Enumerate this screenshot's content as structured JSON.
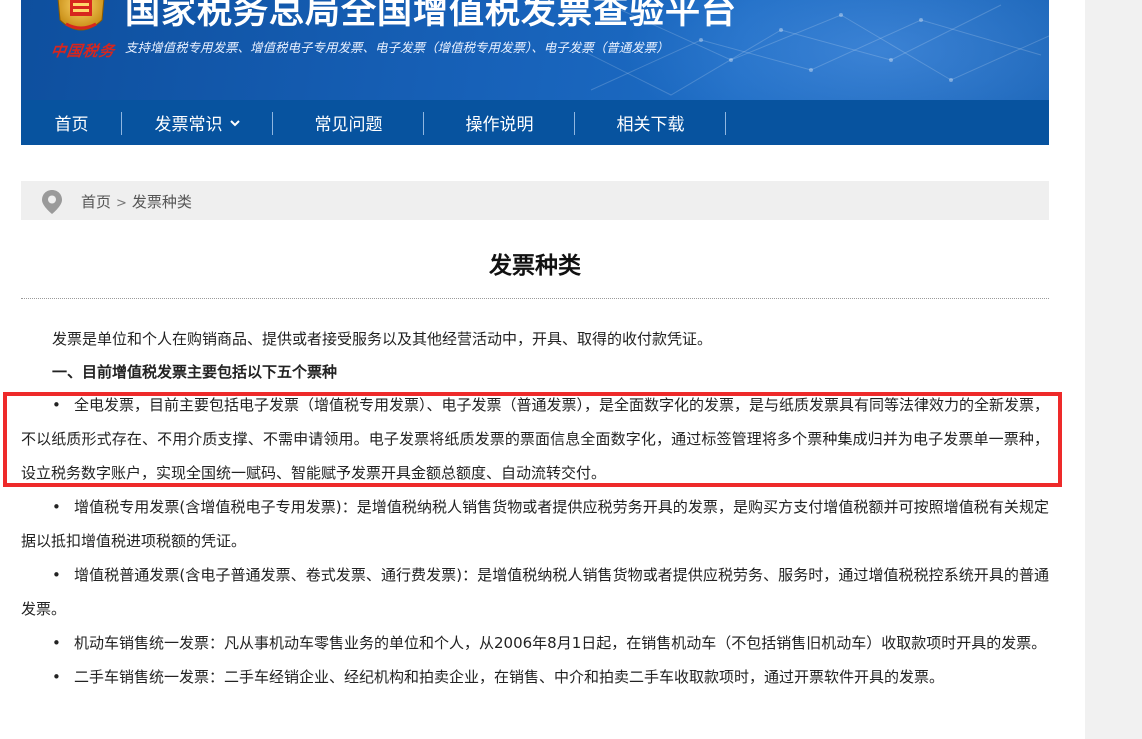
{
  "header": {
    "brand_script": "中国税务",
    "title": "国家税务总局全国增值税发票查验平台",
    "subtitle": "支持增值税专用发票、增值税电子专用发票、电子发票（增值税专用发票）、电子发票（普通发票）"
  },
  "nav": {
    "items": [
      {
        "label": "首页"
      },
      {
        "label": "发票常识",
        "has_dropdown": true
      },
      {
        "label": "常见问题"
      },
      {
        "label": "操作说明"
      },
      {
        "label": "相关下载"
      }
    ]
  },
  "breadcrumb": {
    "home": "首页",
    "separator": ">",
    "current": "发票种类"
  },
  "article": {
    "title": "发票种类",
    "intro": "发票是单位和个人在购销商品、提供或者接受服务以及其他经营活动中，开具、取得的收付款凭证。",
    "heading": "一、目前增值税发票主要包括以下五个票种",
    "bullet_symbol": "•",
    "items": [
      {
        "text": "全电发票，目前主要包括电子发票（增值税专用发票）、电子发票（普通发票），是全面数字化的发票，是与纸质发票具有同等法律效力的全新发票，不以纸质形式存在、不用介质支撑、不需申请领用。电子发票将纸质发票的票面信息全面数字化，通过标签管理将多个票种集成归并为电子发票单一票种，设立税务数字账户，实现全国统一赋码、智能赋予发票开具金额总额度、自动流转交付。",
        "highlighted": true
      },
      {
        "text": "增值税专用发票(含增值税电子专用发票)：是增值税纳税人销售货物或者提供应税劳务开具的发票，是购买方支付增值税额并可按照增值税有关规定据以抵扣增值税进项税额的凭证。"
      },
      {
        "text": "增值税普通发票(含电子普通发票、卷式发票、通行费发票)：是增值税纳税人销售货物或者提供应税劳务、服务时，通过增值税税控系统开具的普通发票。"
      },
      {
        "text": "机动车销售统一发票：凡从事机动车零售业务的单位和个人，从2006年8月1日起，在销售机动车（不包括销售旧机动车）收取款项时开具的发票。"
      },
      {
        "text": "二手车销售统一发票：二手车经销企业、经纪机构和拍卖企业，在销售、中介和拍卖二手车收取款项时，通过开票软件开具的发票。"
      }
    ]
  },
  "colors": {
    "banner": "#1761b8",
    "nav": "#07539f",
    "highlight_border": "#ee2a2a",
    "brand_script": "#d7261e"
  }
}
